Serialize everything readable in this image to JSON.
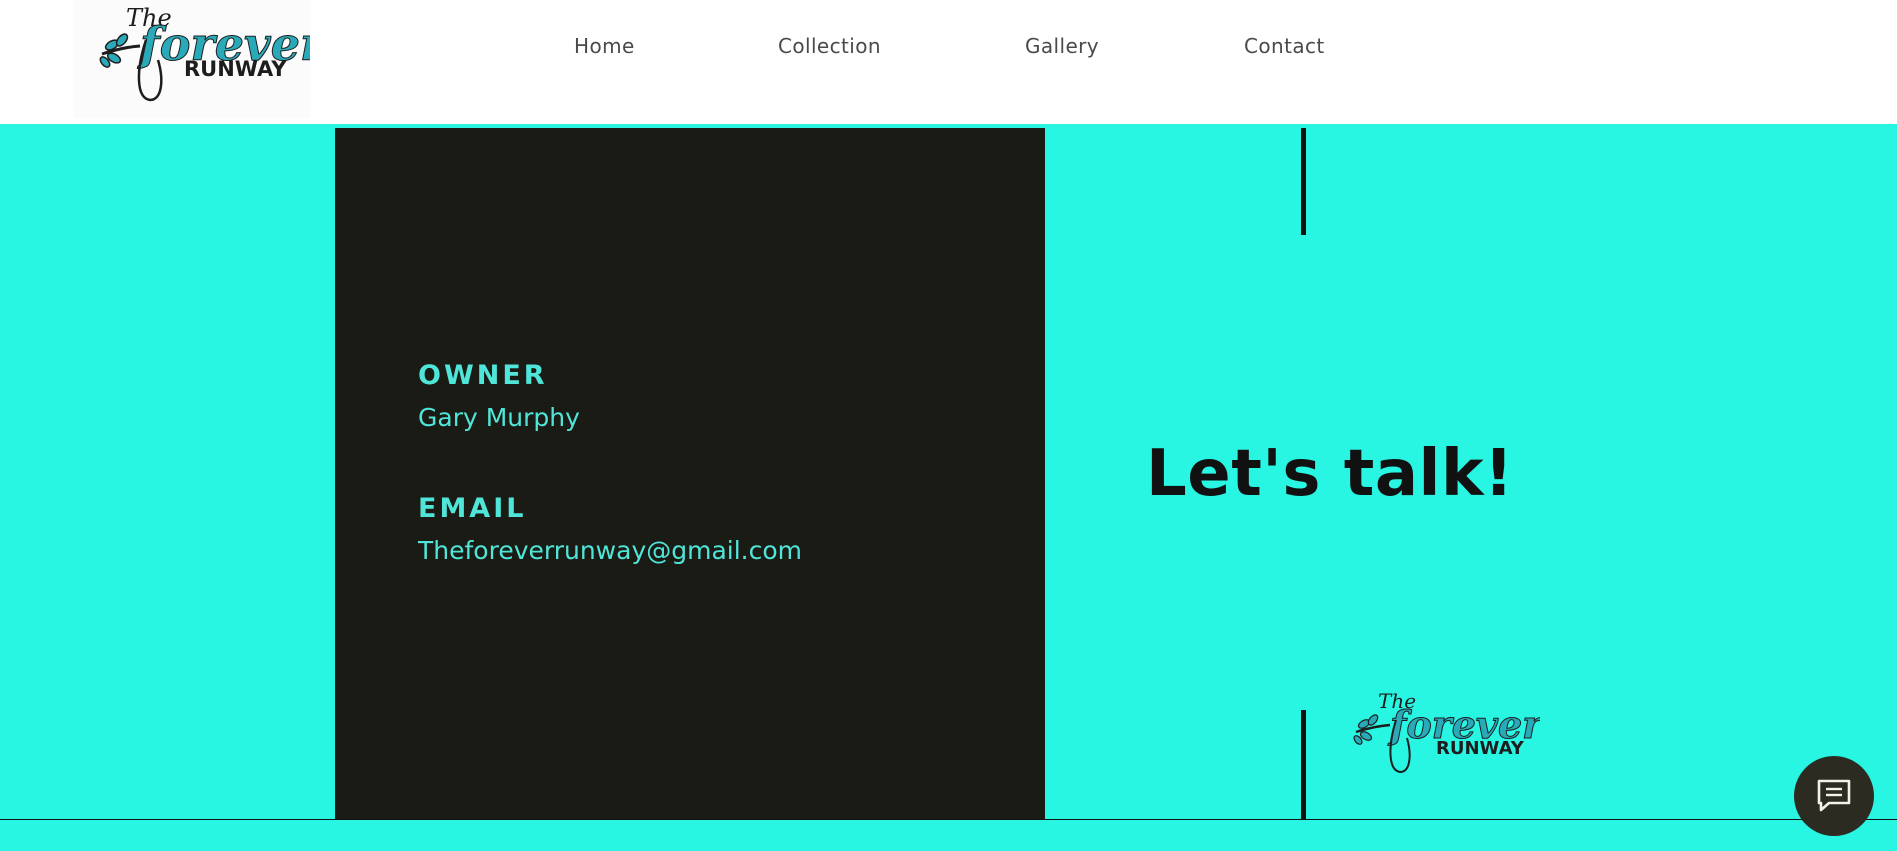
{
  "header": {
    "logo": {
      "word_the": "The",
      "word_forever": "forever",
      "word_runway": "RUNWAY"
    },
    "nav": [
      {
        "label": "Home"
      },
      {
        "label": "Collection"
      },
      {
        "label": "Gallery"
      },
      {
        "label": "Contact"
      }
    ]
  },
  "contact_card": {
    "owner_label": "OWNER",
    "owner_name": "Gary Murphy",
    "email_label": "EMAIL",
    "email_value": "Theforeverrunway@gmail.com"
  },
  "cta": {
    "headline": "Let's talk!"
  },
  "chat": {
    "icon": "chat-icon"
  },
  "colors": {
    "background": "#28f5e2",
    "card": "#1b1b15",
    "accent_text": "#4fe6d9",
    "dark": "#111111",
    "logo_teal": "#2aa9b8"
  }
}
